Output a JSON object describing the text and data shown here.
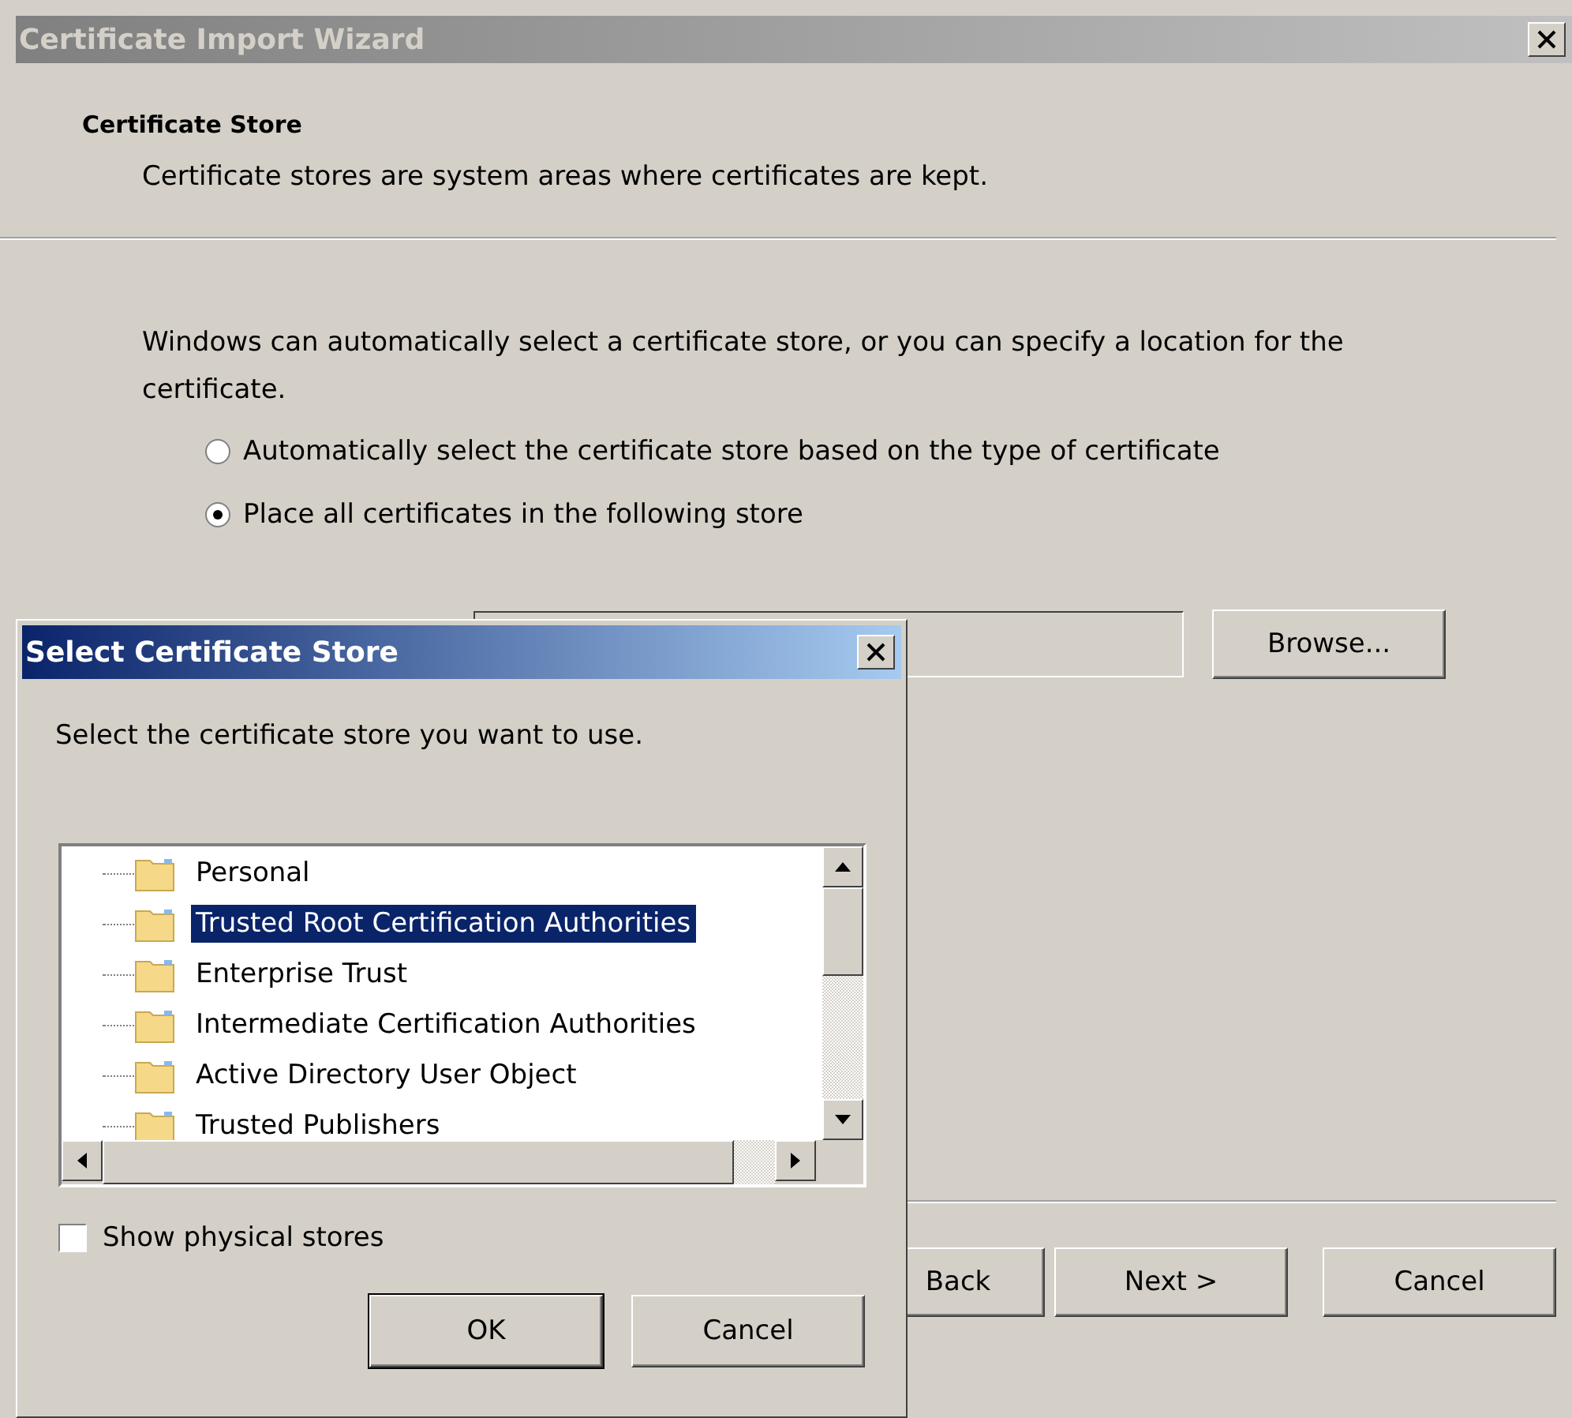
{
  "window": {
    "title": "Certificate Import Wizard"
  },
  "header": {
    "title": "Certificate Store",
    "description": "Certificate stores are system areas where certificates are kept."
  },
  "intro": "Windows can automatically select a certificate store, or you can specify a location for the certificate.",
  "options": [
    {
      "label": "Automatically select the certificate store based on the type of certificate",
      "selected": false
    },
    {
      "label": "Place all certificates in the following store",
      "selected": true
    }
  ],
  "browse_button": "Browse...",
  "footer_buttons": [
    "Back",
    "Next >",
    "Cancel"
  ],
  "dialog": {
    "title": "Select Certificate Store",
    "prompt": "Select the certificate store you want to use.",
    "stores": [
      {
        "name": "Personal",
        "selected": false
      },
      {
        "name": "Trusted Root Certification Authorities",
        "selected": true
      },
      {
        "name": "Enterprise Trust",
        "selected": false
      },
      {
        "name": "Intermediate Certification Authorities",
        "selected": false
      },
      {
        "name": "Active Directory User Object",
        "selected": false
      },
      {
        "name": "Trusted Publishers",
        "selected": false
      }
    ],
    "show_physical": {
      "label": "Show physical stores",
      "checked": false
    },
    "buttons": [
      "OK",
      "Cancel"
    ]
  }
}
